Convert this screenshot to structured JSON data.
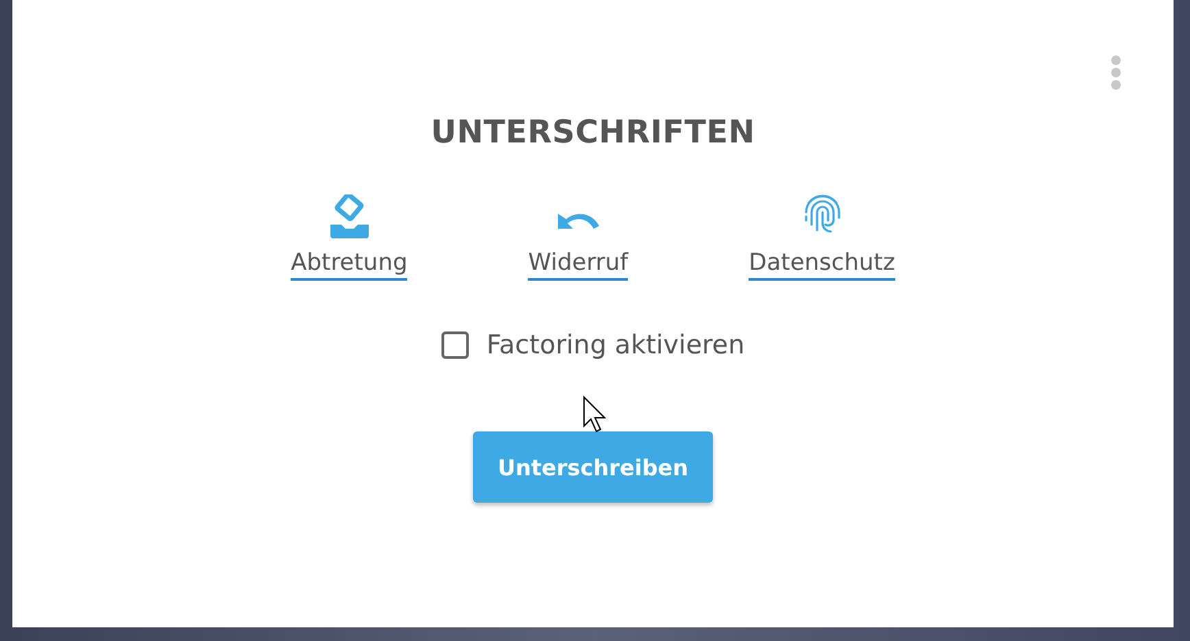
{
  "dialog": {
    "title": "UNTERSCHRIFTEN",
    "actions": [
      {
        "kind": "assign",
        "label": "Abtretung"
      },
      {
        "kind": "undo",
        "label": "Widerruf"
      },
      {
        "kind": "fingerprint",
        "label": "Datenschutz"
      }
    ],
    "checkbox": {
      "label": "Factoring aktivieren",
      "checked": false
    },
    "button": "Unterschreiben"
  }
}
